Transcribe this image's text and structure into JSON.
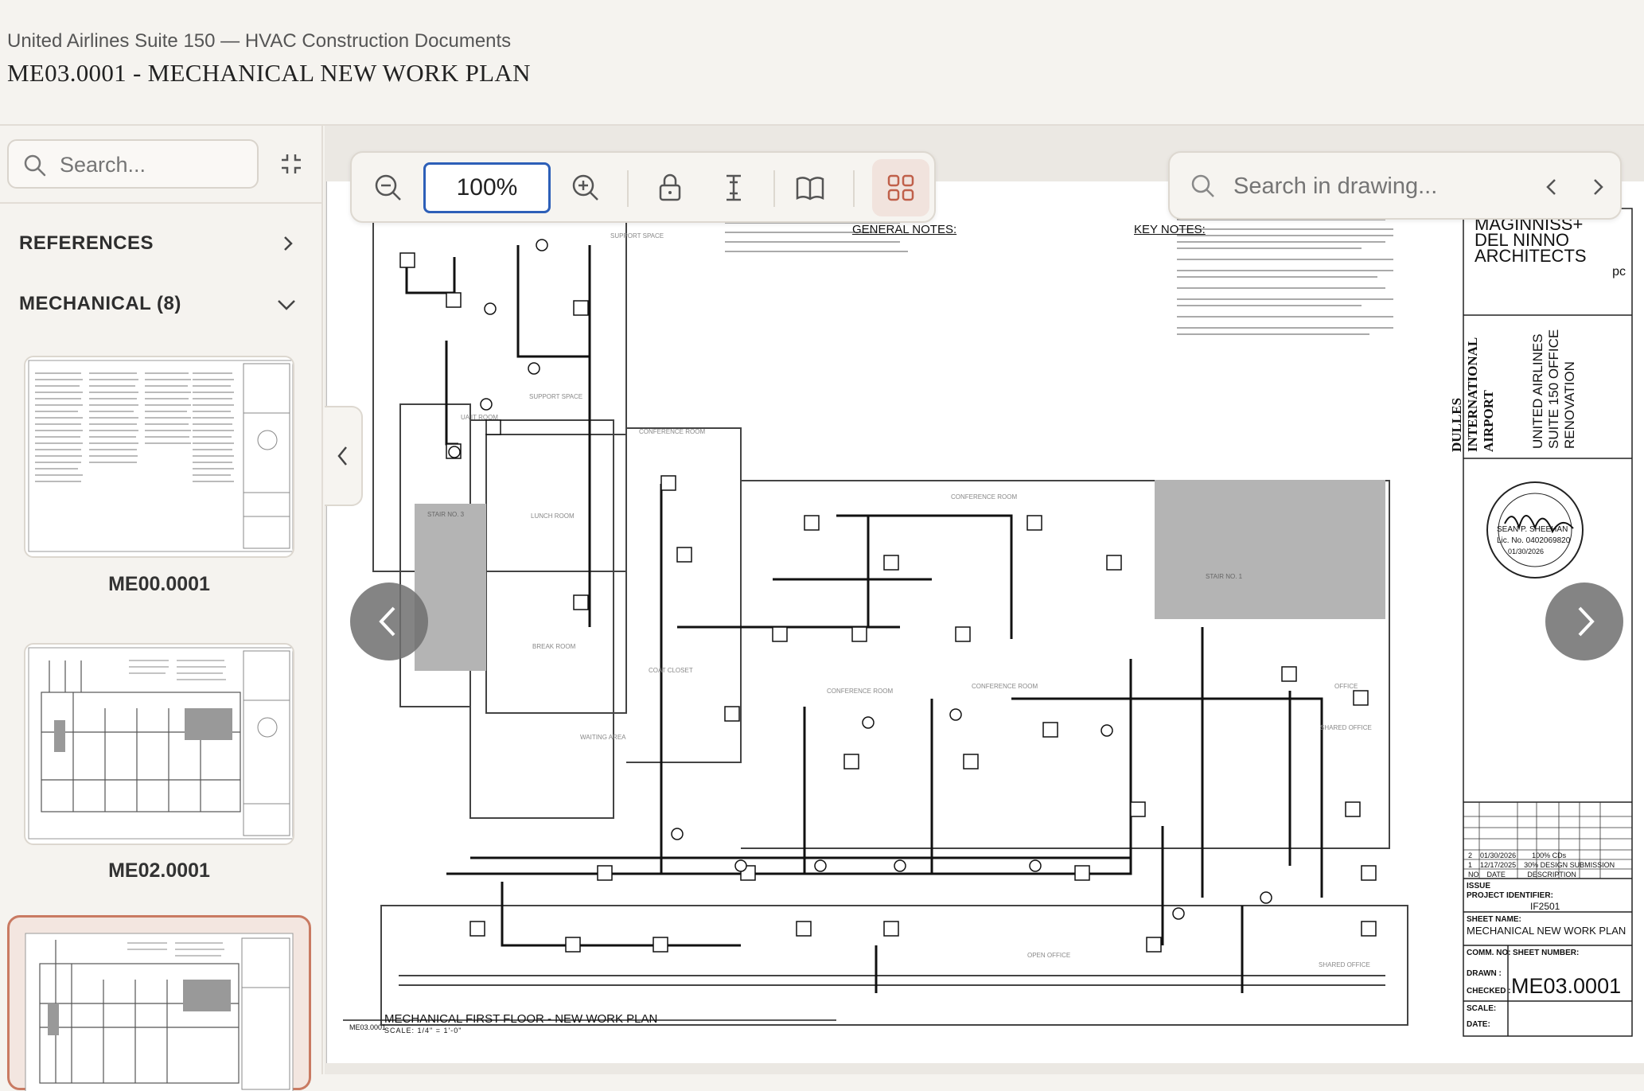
{
  "header": {
    "subtitle": "United Airlines Suite 150 — HVAC Construction Documents",
    "title": "ME03.0001 - MECHANICAL NEW WORK PLAN"
  },
  "sidebar": {
    "search_placeholder": "Search...",
    "sections": [
      {
        "label": "REFERENCES",
        "icon": "chevron-right-icon"
      },
      {
        "label": "MECHANICAL (8)",
        "icon": "chevron-down-icon"
      }
    ],
    "thumbnails": [
      {
        "label": "ME00.0001"
      },
      {
        "label": "ME02.0001"
      },
      {
        "label": ""
      }
    ]
  },
  "toolbar": {
    "zoom_value": "100%",
    "icons": [
      "zoom-out-icon",
      "zoom-in-icon",
      "lock-icon",
      "text-cursor-icon",
      "book-icon",
      "grid-icon"
    ]
  },
  "find": {
    "placeholder": "Search in drawing..."
  },
  "drawing": {
    "general_notes_title": "GENERAL NOTES:",
    "key_notes_title": "KEY NOTES:",
    "firm_line1": "MAGINNISS+",
    "firm_line2": "DEL NINNO",
    "firm_line3": "ARCHITECTS",
    "firm_suffix": "pc",
    "airport_line1": "DULLES",
    "airport_line2": "INTERNATIONAL",
    "airport_line3": "AIRPORT",
    "project_line1": "UNITED AIRLINES",
    "project_line2": "SUITE 150 OFFICE",
    "project_line3": "RENOVATION",
    "seal_name": "SEAN P. SHEEHAN",
    "seal_lic": "Lic. No. 0402069820",
    "seal_date": "01/30/2026",
    "issues": [
      {
        "no": "2",
        "date": "01/30/2026",
        "desc": "100% CDs"
      },
      {
        "no": "1",
        "date": "12/17/2025",
        "desc": "30% DESIGN SUBMISSION"
      }
    ],
    "issue_headers": [
      "NO",
      "DATE",
      "DESCRIPTION"
    ],
    "issue_label": "ISSUE",
    "project_identifier_label": "PROJECT IDENTIFIER:",
    "project_identifier": "IF2501",
    "sheet_name_label": "SHEET NAME:",
    "sheet_name": "MECHANICAL NEW WORK PLAN",
    "comm_label": "COMM. NO:",
    "sheet_number_label": "SHEET NUMBER:",
    "drawn_label": "DRAWN :",
    "checked_label": "CHECKED :",
    "scale_label": "SCALE:",
    "date_label": "DATE:",
    "sheet_number": "ME03.0001",
    "plan_caption": "MECHANICAL FIRST FLOOR - NEW WORK PLAN",
    "plan_ref": "ME03.0001",
    "plan_scale": "SCALE: 1/4\" = 1'-0\"",
    "rooms": [
      "SUPPORT SPACE",
      "UA IT ROOM",
      "SUPPORT SPACE",
      "CONFERENCE ROOM",
      "LUNCH ROOM",
      "STAIR NO. 3",
      "BREAK ROOM",
      "COAT CLOSET",
      "WAITING AREA",
      "CONFERENCE ROOM",
      "CONFERENCE ROOM",
      "CONFERENCE ROOM",
      "STAIR NO. 1",
      "OFFICE",
      "SHARED OFFICE",
      "OPEN OFFICE",
      "SHARED OFFICE"
    ]
  }
}
